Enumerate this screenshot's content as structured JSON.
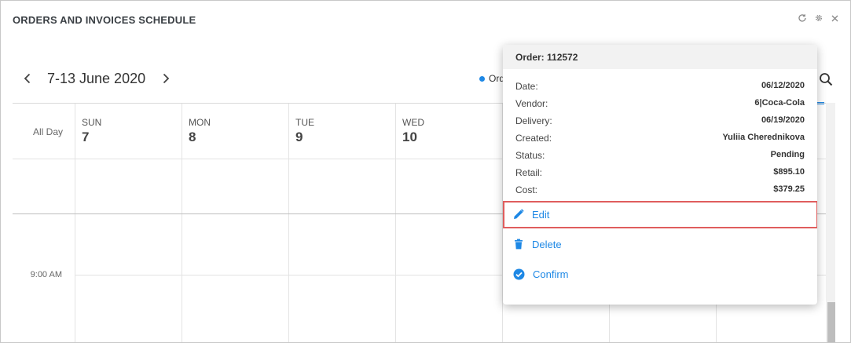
{
  "panel": {
    "title": "ORDERS AND INVOICES SCHEDULE",
    "tools": [
      "refresh-icon",
      "gear-icon",
      "close-icon"
    ]
  },
  "calendar": {
    "date_range": "7-13 June 2020",
    "legend_label": "Ord",
    "legend_color": "#1e88e5",
    "days": [
      {
        "name": "SUN",
        "num": "7"
      },
      {
        "name": "MON",
        "num": "8"
      },
      {
        "name": "TUE",
        "num": "9"
      },
      {
        "name": "WED",
        "num": "10"
      }
    ],
    "all_day_label": "All Day",
    "time_label": "9:00 AM"
  },
  "popup": {
    "title": "Order: 112572",
    "details": [
      {
        "label": "Date:",
        "value": "06/12/2020"
      },
      {
        "label": "Vendor:",
        "value": "6|Coca-Cola"
      },
      {
        "label": "Delivery:",
        "value": "06/19/2020"
      },
      {
        "label": "Created:",
        "value": "Yuliia Cherednikova"
      },
      {
        "label": "Status:",
        "value": "Pending"
      },
      {
        "label": "Retail:",
        "value": "$895.10"
      },
      {
        "label": "Cost:",
        "value": "$379.25"
      }
    ],
    "actions": {
      "edit": "Edit",
      "delete": "Delete",
      "confirm": "Confirm"
    },
    "accent_color": "#1e88e5",
    "highlight_color": "#e05d5d"
  }
}
